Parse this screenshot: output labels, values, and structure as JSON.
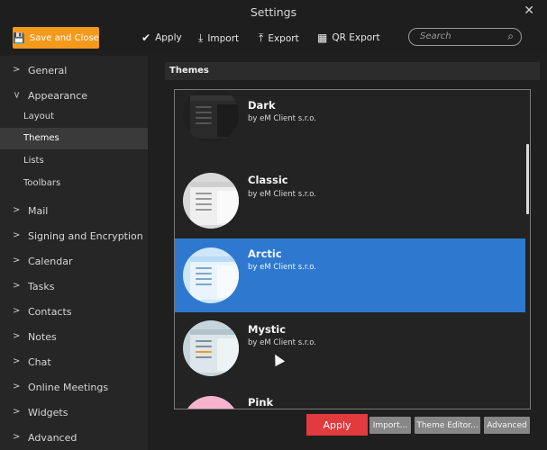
{
  "window": {
    "title": "Settings",
    "close_glyph": "✕"
  },
  "toolbar": {
    "save_close": "Save and Close",
    "apply": "Apply",
    "import": "Import",
    "export": "Export",
    "qr_export": "QR Export",
    "search_placeholder": "Search"
  },
  "sidebar": {
    "general": "General",
    "appearance": "Appearance",
    "appearance_sub": [
      "Layout",
      "Themes",
      "Lists",
      "Toolbars"
    ],
    "rest": [
      "Mail",
      "Signing and Encryption",
      "Calendar",
      "Tasks",
      "Contacts",
      "Notes",
      "Chat",
      "Online Meetings",
      "Widgets",
      "Advanced"
    ]
  },
  "section": {
    "title": "Themes"
  },
  "themes": [
    {
      "name": "Dark",
      "author": "by eM Client s.r.o.",
      "selected": false
    },
    {
      "name": "Classic",
      "author": "by eM Client s.r.o.",
      "selected": false
    },
    {
      "name": "Arctic",
      "author": "by eM Client s.r.o.",
      "selected": true
    },
    {
      "name": "Mystic",
      "author": "by eM Client s.r.o.",
      "selected": false
    },
    {
      "name": "Pink",
      "author": "",
      "selected": false
    }
  ],
  "buttons": {
    "apply": "Apply",
    "import": "Import...",
    "theme_editor": "Theme Editor...",
    "advanced": "Advanced"
  },
  "colors": {
    "accent_orange": "#f39a1d",
    "selection_blue": "#2e79cf",
    "apply_red": "#e13a3f"
  }
}
